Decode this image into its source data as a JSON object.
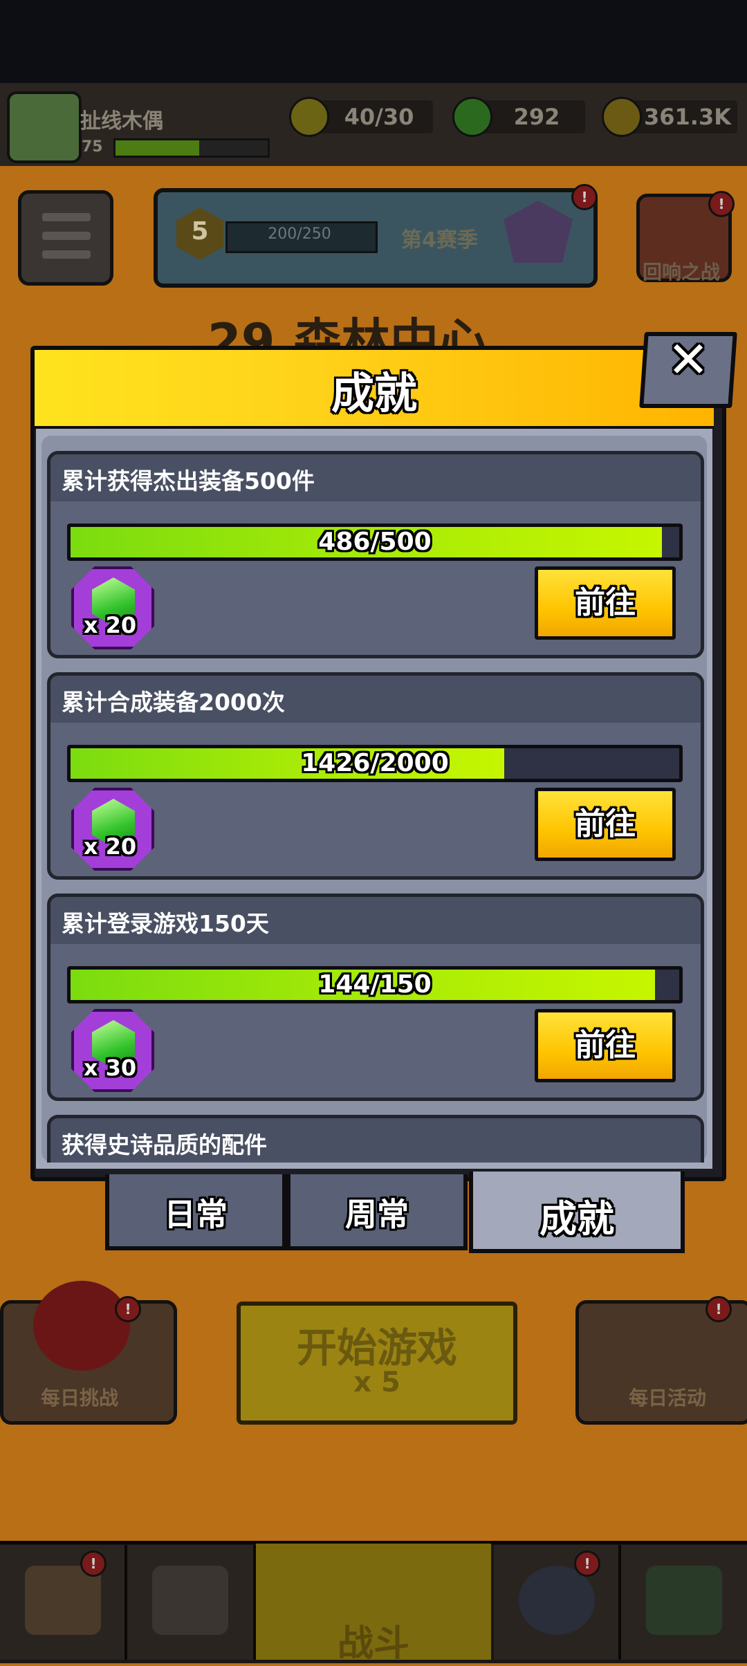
{
  "hud": {
    "player_name": "扯线木偶",
    "player_level": "75",
    "energy": "40/30",
    "gems": "292",
    "coins": "361.3K"
  },
  "season": {
    "level": "5",
    "progress": "200/250",
    "label": "第4赛季",
    "badge": "!"
  },
  "echo": {
    "label": "回响之战",
    "badge": "!"
  },
  "level_title": "29.森林中心",
  "modal": {
    "title": "成就",
    "close_glyph": "✕",
    "achievements": [
      {
        "title": "累计获得杰出装备500件",
        "progress_text": "486/500",
        "progress": 0.972,
        "reward_qty": "x 20",
        "button": "前往"
      },
      {
        "title": "累计合成装备2000次",
        "progress_text": "1426/2000",
        "progress": 0.713,
        "reward_qty": "x 20",
        "button": "前往"
      },
      {
        "title": "累计登录游戏150天",
        "progress_text": "144/150",
        "progress": 0.96,
        "reward_qty": "x 30",
        "button": "前往"
      },
      {
        "title": "获得史诗品质的配件"
      }
    ],
    "tabs": [
      "日常",
      "周常",
      "成就"
    ]
  },
  "bottom": {
    "daily_challenge": "每日挑战",
    "start_game": "开始游戏",
    "start_cost": "x 5",
    "daily_event": "每日活动",
    "battle": "战斗",
    "badge": "!"
  },
  "colors": {
    "accent_yellow": "#ffd21a",
    "progress_green": "#a6ea07",
    "reward_purple": "#a43ed9",
    "card_bg": "#5d6378"
  }
}
